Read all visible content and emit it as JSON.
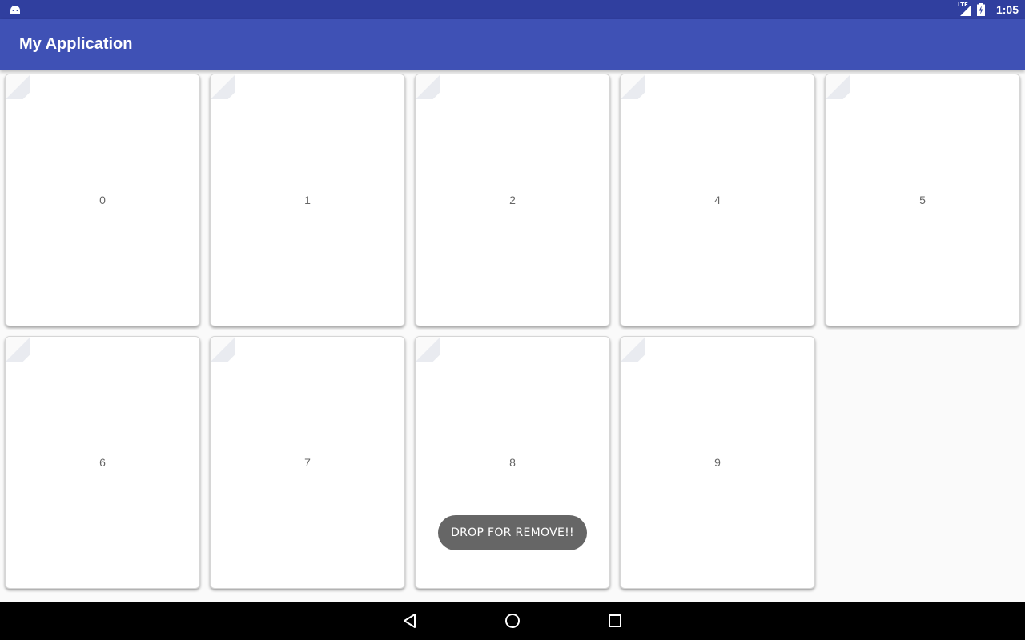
{
  "status_bar": {
    "left_icon": "android-icon",
    "network_label": "LTE",
    "signal_icon": "signal-icon",
    "battery_icon": "battery-charging-icon",
    "time": "1:05"
  },
  "app_bar": {
    "title": "My Application"
  },
  "cards": [
    {
      "label": "0"
    },
    {
      "label": "1"
    },
    {
      "label": "2"
    },
    {
      "label": "4"
    },
    {
      "label": "5"
    },
    {
      "label": "6"
    },
    {
      "label": "7"
    },
    {
      "label": "8"
    },
    {
      "label": "9"
    }
  ],
  "toast": {
    "text": "DROP FOR REMOVE!!"
  },
  "nav_bar": {
    "back_icon": "back-triangle-icon",
    "home_icon": "home-circle-icon",
    "recents_icon": "recents-square-icon"
  },
  "colors": {
    "status_bar": "#303f9f",
    "app_bar": "#3f51b5",
    "background": "#fafafa",
    "toast": "#666666",
    "nav_bar": "#000000"
  }
}
